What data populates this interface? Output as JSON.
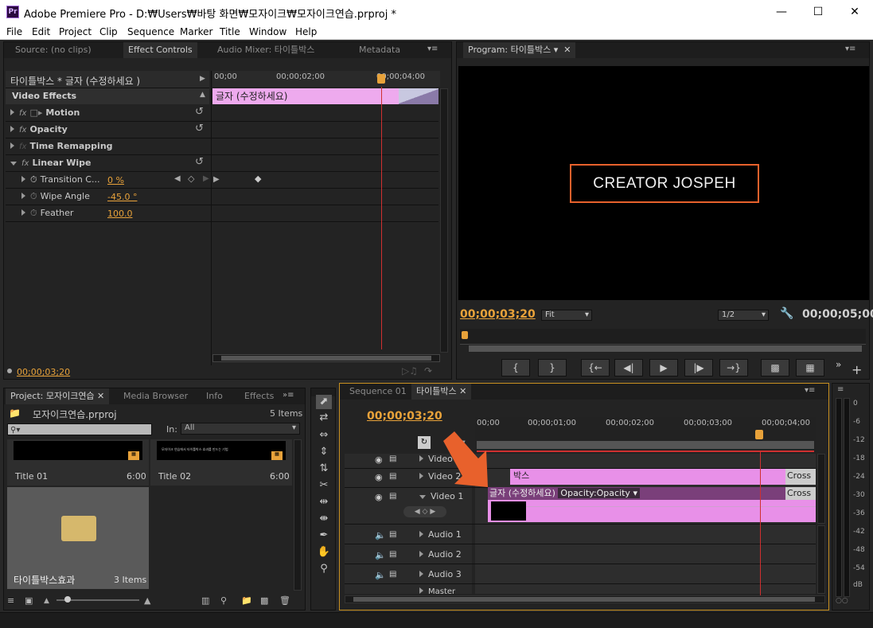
{
  "window": {
    "app_icon": "Pr",
    "title": "Adobe Premiere Pro - D:₩Users₩바탕 화면₩모자이크₩모자이크연습.prproj *"
  },
  "menu": [
    "File",
    "Edit",
    "Project",
    "Clip",
    "Sequence",
    "Marker",
    "Title",
    "Window",
    "Help"
  ],
  "source_panel": {
    "tabs": [
      "Source: (no clips)",
      "Effect Controls",
      "Audio Mixer: 타이틀박스",
      "Metadata"
    ],
    "clip_name": "타이틀박스 * 글자 (수정하세요 )",
    "ruler": [
      "00;00",
      "00;00;02;00",
      "00;00;04;00"
    ],
    "clip_label": "글자 (수정하세요)",
    "video_effects_label": "Video Effects",
    "effects": [
      {
        "name": "Motion"
      },
      {
        "name": "Opacity"
      },
      {
        "name": "Time Remapping"
      },
      {
        "name": "Linear Wipe"
      }
    ],
    "params": [
      {
        "name": "Transition C...",
        "value": "0 %"
      },
      {
        "name": "Wipe Angle",
        "value": "-45.0 °"
      },
      {
        "name": "Feather",
        "value": "100.0"
      }
    ],
    "timecode": "00;00;03;20"
  },
  "program": {
    "tab": "Program: 타이틀박스",
    "overlay_text": "CREATOR JOSPEH",
    "current_time": "00;00;03;20",
    "zoom": "Fit",
    "resolution": "1/2",
    "duration": "00;00;05;00"
  },
  "project": {
    "tabs": [
      "Project: 모자이크연습",
      "Media Browser",
      "Info",
      "Effects"
    ],
    "file": "모자이크연습.prproj",
    "count": "5 Items",
    "in_label": "In:",
    "in_value": "All",
    "items": [
      {
        "name": "Title 01",
        "duration": "6:00",
        "thumb_text": ""
      },
      {
        "name": "Title 02",
        "duration": "6:00",
        "thumb_text": "모자이크 연습에서 타이틀박스 효과를 만드는 기법"
      },
      {
        "name": "타이틀박스효과",
        "duration": "3 Items"
      }
    ]
  },
  "timeline": {
    "tabs": [
      "Sequence 01",
      "타이틀박스"
    ],
    "timecode": "00;00;03;20",
    "ruler": [
      "00;00",
      "00;00;01;00",
      "00;00;02;00",
      "00;00;03;00",
      "00;00;04;00"
    ],
    "tracks": [
      "Video 3",
      "Video 2",
      "Video 1",
      "Audio 1",
      "Audio 2",
      "Audio 3",
      "Master"
    ],
    "clip_box": "박스",
    "clip_text": "글자 (수정하세요)",
    "clip_text_fx": "Opacity:Opacity",
    "transition": "Cross"
  },
  "audio_meter": {
    "labels": [
      "0",
      "-6",
      "-12",
      "-18",
      "-24",
      "-30",
      "-36",
      "-42",
      "-48",
      "-54",
      "dB"
    ]
  },
  "colors": {
    "accent": "#e8a23a",
    "clip_pink": "#e890e8",
    "clip_dark": "#7a3f7a",
    "playhead": "#d03030",
    "title_box_border": "#e8612c"
  }
}
